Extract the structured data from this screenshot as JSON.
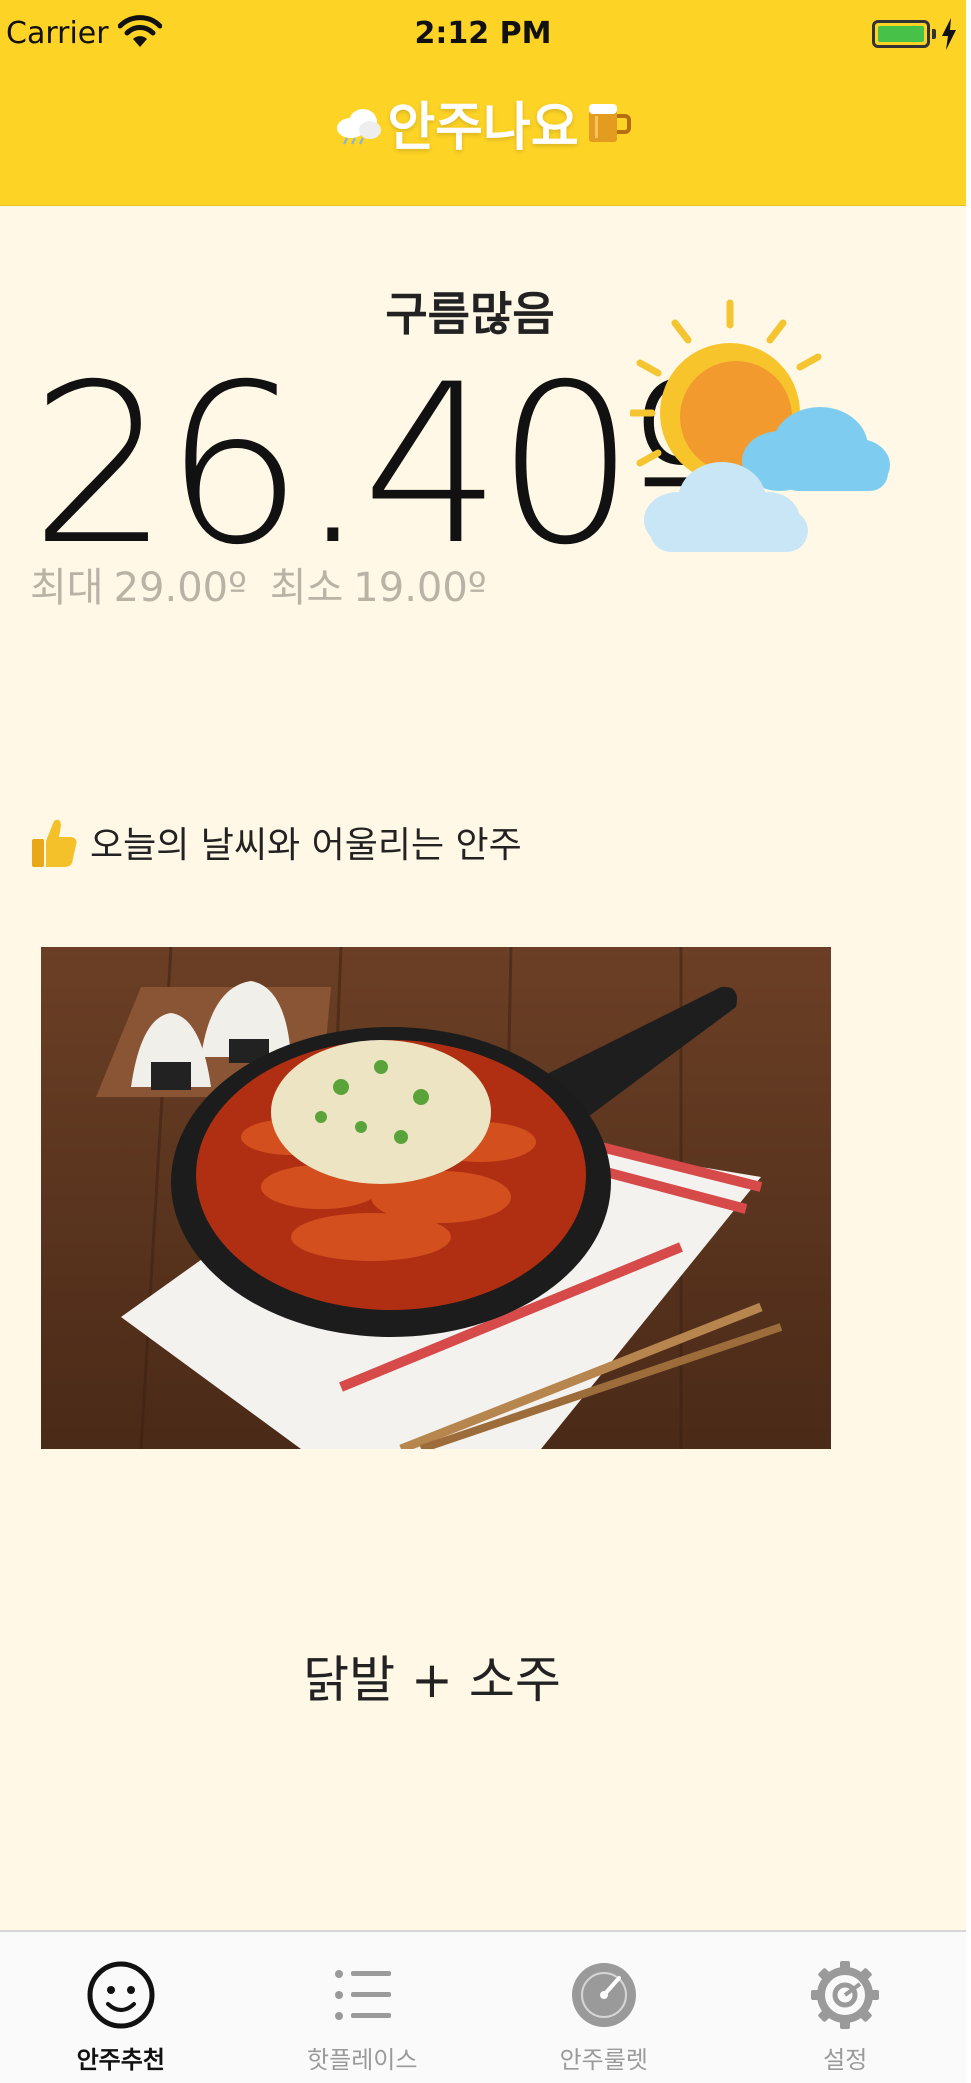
{
  "status_bar": {
    "carrier": "Carrier",
    "time": "2:12 PM",
    "battery_color": "#48c148"
  },
  "nav": {
    "title": "안주나요",
    "left_icon": "cloud-icon",
    "right_icon": "beer-icon",
    "background": "#fdd326"
  },
  "weather": {
    "condition": "구름많음",
    "temperature": "26.40º",
    "max_label": "최대",
    "max_value": "29.00º",
    "min_label": "최소",
    "min_value": "19.00º",
    "icon": "sun-behind-clouds-icon"
  },
  "recommendation": {
    "heading": "오늘의 날씨와 어울리는 안주",
    "heading_icon": "thumbs-up-icon",
    "image": "spicy-chicken-feet-skillet-photo",
    "pairing": "닭발 + 소주"
  },
  "tabbar": {
    "tabs": [
      {
        "label": "안주추천",
        "icon": "smiley-icon",
        "active": true
      },
      {
        "label": "핫플레이스",
        "icon": "list-icon",
        "active": false
      },
      {
        "label": "안주룰렛",
        "icon": "gauge-icon",
        "active": false
      },
      {
        "label": "설정",
        "icon": "gear-icon",
        "active": false
      }
    ]
  }
}
